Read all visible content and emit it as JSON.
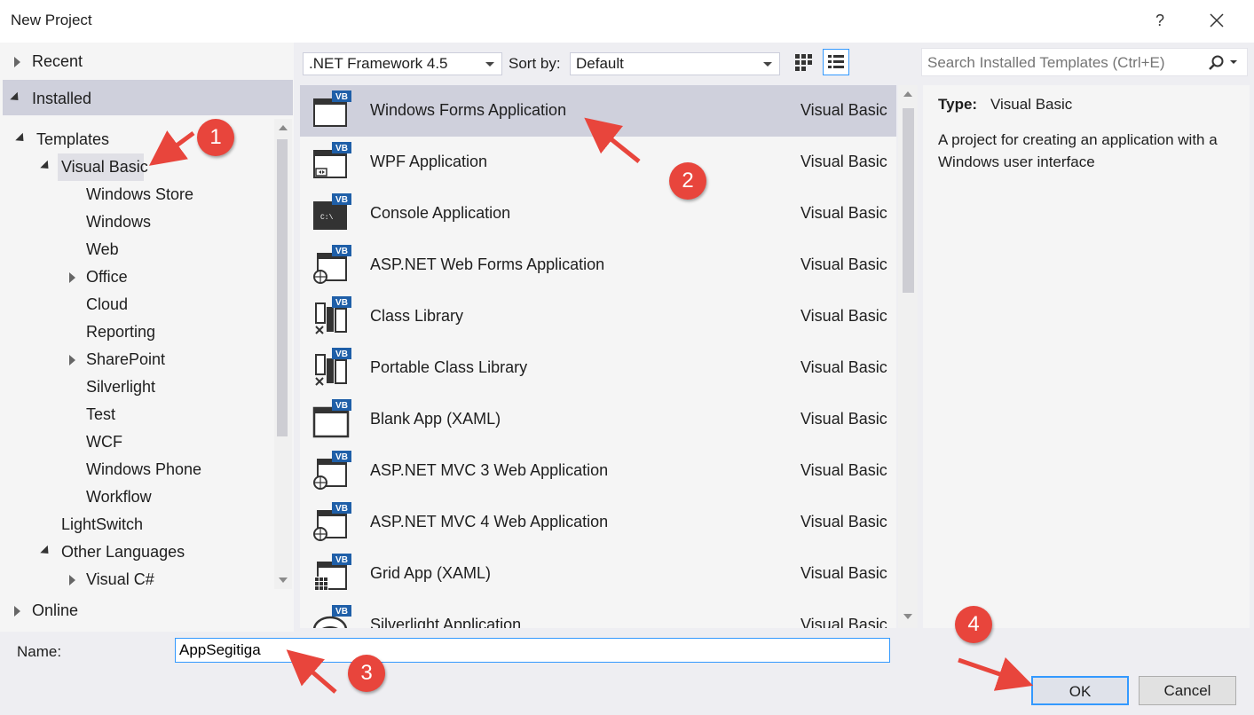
{
  "window": {
    "title": "New Project",
    "help_label": "?"
  },
  "nav": {
    "recent": "Recent",
    "installed": "Installed",
    "templates": "Templates",
    "visual_basic": "Visual Basic",
    "vb_children": [
      "Windows Store",
      "Windows",
      "Web",
      "Office",
      "Cloud",
      "Reporting",
      "SharePoint",
      "Silverlight",
      "Test",
      "WCF",
      "Windows Phone",
      "Workflow"
    ],
    "lightswitch": "LightSwitch",
    "other_languages": "Other Languages",
    "visual_csharp": "Visual C#",
    "online": "Online"
  },
  "toolbar": {
    "framework": ".NET Framework 4.5",
    "sort_label": "Sort by:",
    "sort_value": "Default",
    "search_placeholder": "Search Installed Templates (Ctrl+E)"
  },
  "templates": [
    {
      "name": "Windows Forms Application",
      "lang": "Visual Basic",
      "icon": "vb-winforms-icon"
    },
    {
      "name": "WPF Application",
      "lang": "Visual Basic",
      "icon": "vb-wpf-icon"
    },
    {
      "name": "Console Application",
      "lang": "Visual Basic",
      "icon": "vb-console-icon"
    },
    {
      "name": "ASP.NET Web Forms Application",
      "lang": "Visual Basic",
      "icon": "vb-web-icon"
    },
    {
      "name": "Class Library",
      "lang": "Visual Basic",
      "icon": "vb-classlib-icon"
    },
    {
      "name": "Portable Class Library",
      "lang": "Visual Basic",
      "icon": "vb-portable-icon"
    },
    {
      "name": "Blank App (XAML)",
      "lang": "Visual Basic",
      "icon": "vb-blankapp-icon"
    },
    {
      "name": "ASP.NET MVC 3 Web Application",
      "lang": "Visual Basic",
      "icon": "vb-mvc3-icon"
    },
    {
      "name": "ASP.NET MVC 4 Web Application",
      "lang": "Visual Basic",
      "icon": "vb-mvc4-icon"
    },
    {
      "name": "Grid App (XAML)",
      "lang": "Visual Basic",
      "icon": "vb-gridapp-icon"
    },
    {
      "name": "Silverlight Application",
      "lang": "Visual Basic",
      "icon": "vb-silverlight-icon"
    }
  ],
  "details": {
    "type_label": "Type:",
    "type_value": "Visual Basic",
    "description": "A project for creating an application with a Windows user interface"
  },
  "form": {
    "name_label": "Name:",
    "name_value": "AppSegitiga"
  },
  "buttons": {
    "ok": "OK",
    "cancel": "Cancel"
  },
  "callouts": [
    "1",
    "2",
    "3",
    "4"
  ],
  "colors": {
    "accent": "#3399ff",
    "selection": "#cfd0dc",
    "callout": "#e8453c",
    "vb_badge": "#1f5fa8"
  }
}
